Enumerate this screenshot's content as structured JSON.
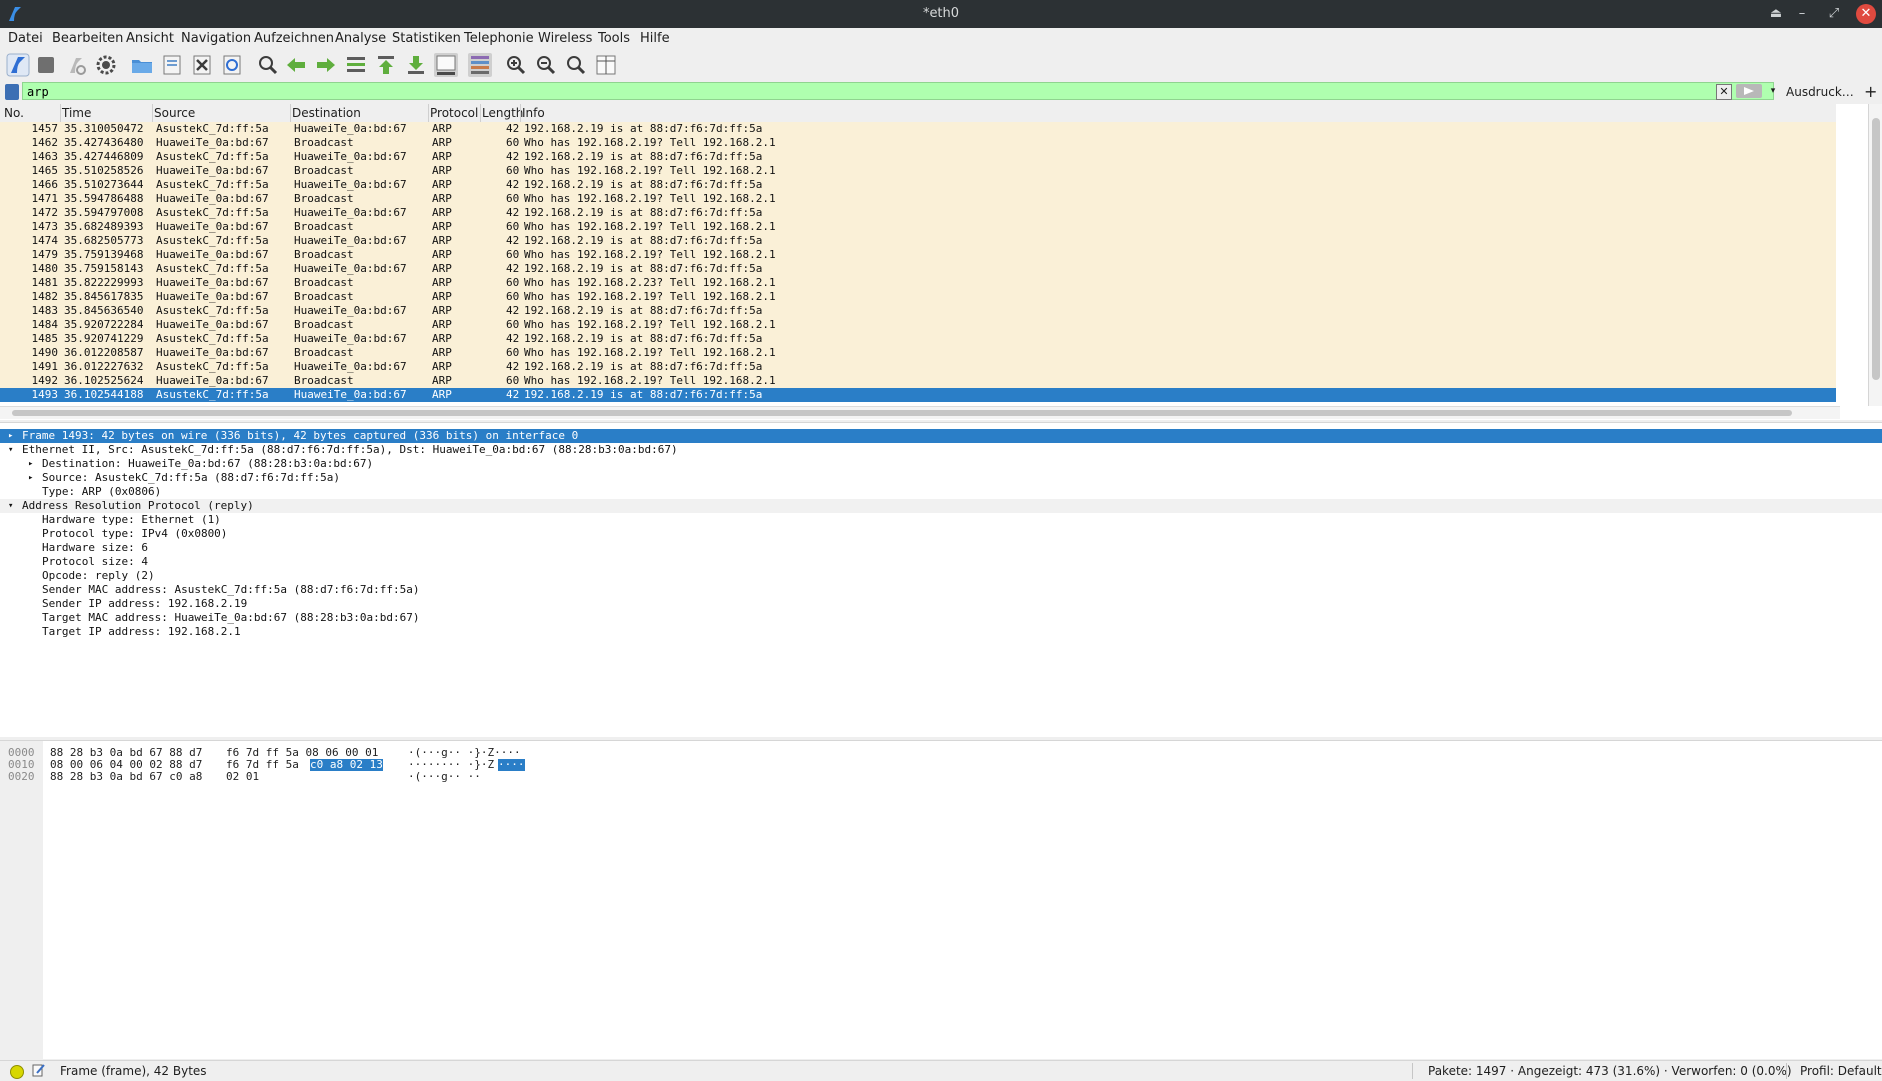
{
  "window": {
    "title": "*eth0"
  },
  "menu": [
    "Datei",
    "Bearbeiten",
    "Ansicht",
    "Navigation",
    "Aufzeichnen",
    "Analyse",
    "Statistiken",
    "Telephonie",
    "Wireless",
    "Tools",
    "Hilfe"
  ],
  "toolbar": {
    "icons": [
      "shark-fin-icon",
      "stop-icon",
      "restart-icon",
      "gear-icon",
      "folder-open-icon",
      "file-icon",
      "close-file-icon",
      "reload-icon",
      "search-icon",
      "arrow-left-icon",
      "arrow-right-icon",
      "go-to-packet-icon",
      "go-first-icon",
      "go-last-icon",
      "auto-scroll-icon",
      "colorize-icon",
      "zoom-in-icon",
      "zoom-out-icon",
      "zoom-normal-icon",
      "resize-columns-icon"
    ]
  },
  "filter": {
    "value": "arp",
    "expression_label": "Ausdruck…",
    "plus_label": "+",
    "clear_label": "✕",
    "dropdown_label": "▾"
  },
  "packet_list": {
    "columns": [
      "No.",
      "Time",
      "Source",
      "Destination",
      "Protocol",
      "Length",
      "Info"
    ],
    "rows": [
      {
        "no": "1457",
        "time": "35.310050472",
        "src": "AsustekC_7d:ff:5a",
        "dst": "HuaweiTe_0a:bd:67",
        "proto": "ARP",
        "len": "42",
        "info": "192.168.2.19 is at 88:d7:f6:7d:ff:5a"
      },
      {
        "no": "1462",
        "time": "35.427436480",
        "src": "HuaweiTe_0a:bd:67",
        "dst": "Broadcast",
        "proto": "ARP",
        "len": "60",
        "info": "Who has 192.168.2.19? Tell 192.168.2.1"
      },
      {
        "no": "1463",
        "time": "35.427446809",
        "src": "AsustekC_7d:ff:5a",
        "dst": "HuaweiTe_0a:bd:67",
        "proto": "ARP",
        "len": "42",
        "info": "192.168.2.19 is at 88:d7:f6:7d:ff:5a"
      },
      {
        "no": "1465",
        "time": "35.510258526",
        "src": "HuaweiTe_0a:bd:67",
        "dst": "Broadcast",
        "proto": "ARP",
        "len": "60",
        "info": "Who has 192.168.2.19? Tell 192.168.2.1"
      },
      {
        "no": "1466",
        "time": "35.510273644",
        "src": "AsustekC_7d:ff:5a",
        "dst": "HuaweiTe_0a:bd:67",
        "proto": "ARP",
        "len": "42",
        "info": "192.168.2.19 is at 88:d7:f6:7d:ff:5a"
      },
      {
        "no": "1471",
        "time": "35.594786488",
        "src": "HuaweiTe_0a:bd:67",
        "dst": "Broadcast",
        "proto": "ARP",
        "len": "60",
        "info": "Who has 192.168.2.19? Tell 192.168.2.1"
      },
      {
        "no": "1472",
        "time": "35.594797008",
        "src": "AsustekC_7d:ff:5a",
        "dst": "HuaweiTe_0a:bd:67",
        "proto": "ARP",
        "len": "42",
        "info": "192.168.2.19 is at 88:d7:f6:7d:ff:5a"
      },
      {
        "no": "1473",
        "time": "35.682489393",
        "src": "HuaweiTe_0a:bd:67",
        "dst": "Broadcast",
        "proto": "ARP",
        "len": "60",
        "info": "Who has 192.168.2.19? Tell 192.168.2.1"
      },
      {
        "no": "1474",
        "time": "35.682505773",
        "src": "AsustekC_7d:ff:5a",
        "dst": "HuaweiTe_0a:bd:67",
        "proto": "ARP",
        "len": "42",
        "info": "192.168.2.19 is at 88:d7:f6:7d:ff:5a"
      },
      {
        "no": "1479",
        "time": "35.759139468",
        "src": "HuaweiTe_0a:bd:67",
        "dst": "Broadcast",
        "proto": "ARP",
        "len": "60",
        "info": "Who has 192.168.2.19? Tell 192.168.2.1"
      },
      {
        "no": "1480",
        "time": "35.759158143",
        "src": "AsustekC_7d:ff:5a",
        "dst": "HuaweiTe_0a:bd:67",
        "proto": "ARP",
        "len": "42",
        "info": "192.168.2.19 is at 88:d7:f6:7d:ff:5a"
      },
      {
        "no": "1481",
        "time": "35.822229993",
        "src": "HuaweiTe_0a:bd:67",
        "dst": "Broadcast",
        "proto": "ARP",
        "len": "60",
        "info": "Who has 192.168.2.23? Tell 192.168.2.1"
      },
      {
        "no": "1482",
        "time": "35.845617835",
        "src": "HuaweiTe_0a:bd:67",
        "dst": "Broadcast",
        "proto": "ARP",
        "len": "60",
        "info": "Who has 192.168.2.19? Tell 192.168.2.1"
      },
      {
        "no": "1483",
        "time": "35.845636540",
        "src": "AsustekC_7d:ff:5a",
        "dst": "HuaweiTe_0a:bd:67",
        "proto": "ARP",
        "len": "42",
        "info": "192.168.2.19 is at 88:d7:f6:7d:ff:5a"
      },
      {
        "no": "1484",
        "time": "35.920722284",
        "src": "HuaweiTe_0a:bd:67",
        "dst": "Broadcast",
        "proto": "ARP",
        "len": "60",
        "info": "Who has 192.168.2.19? Tell 192.168.2.1"
      },
      {
        "no": "1485",
        "time": "35.920741229",
        "src": "AsustekC_7d:ff:5a",
        "dst": "HuaweiTe_0a:bd:67",
        "proto": "ARP",
        "len": "42",
        "info": "192.168.2.19 is at 88:d7:f6:7d:ff:5a"
      },
      {
        "no": "1490",
        "time": "36.012208587",
        "src": "HuaweiTe_0a:bd:67",
        "dst": "Broadcast",
        "proto": "ARP",
        "len": "60",
        "info": "Who has 192.168.2.19? Tell 192.168.2.1"
      },
      {
        "no": "1491",
        "time": "36.012227632",
        "src": "AsustekC_7d:ff:5a",
        "dst": "HuaweiTe_0a:bd:67",
        "proto": "ARP",
        "len": "42",
        "info": "192.168.2.19 is at 88:d7:f6:7d:ff:5a"
      },
      {
        "no": "1492",
        "time": "36.102525624",
        "src": "HuaweiTe_0a:bd:67",
        "dst": "Broadcast",
        "proto": "ARP",
        "len": "60",
        "info": "Who has 192.168.2.19? Tell 192.168.2.1"
      },
      {
        "no": "1493",
        "time": "36.102544188",
        "src": "AsustekC_7d:ff:5a",
        "dst": "HuaweiTe_0a:bd:67",
        "proto": "ARP",
        "len": "42",
        "info": "192.168.2.19 is at 88:d7:f6:7d:ff:5a",
        "selected": true
      }
    ]
  },
  "details": [
    {
      "text": "Frame 1493: 42 bytes on wire (336 bits), 42 bytes captured (336 bits) on interface 0",
      "level": 0,
      "arrow": "▸",
      "selected": true
    },
    {
      "text": "Ethernet II, Src: AsustekC_7d:ff:5a (88:d7:f6:7d:ff:5a), Dst: HuaweiTe_0a:bd:67 (88:28:b3:0a:bd:67)",
      "level": 0,
      "arrow": "▾"
    },
    {
      "text": "Destination: HuaweiTe_0a:bd:67 (88:28:b3:0a:bd:67)",
      "level": 1,
      "arrow": "▸"
    },
    {
      "text": "Source: AsustekC_7d:ff:5a (88:d7:f6:7d:ff:5a)",
      "level": 1,
      "arrow": "▸"
    },
    {
      "text": "Type: ARP (0x0806)",
      "level": 1,
      "arrow": ""
    },
    {
      "text": "Address Resolution Protocol (reply)",
      "level": 0,
      "arrow": "▾",
      "section": true
    },
    {
      "text": "Hardware type: Ethernet (1)",
      "level": 1,
      "arrow": ""
    },
    {
      "text": "Protocol type: IPv4 (0x0800)",
      "level": 1,
      "arrow": ""
    },
    {
      "text": "Hardware size: 6",
      "level": 1,
      "arrow": ""
    },
    {
      "text": "Protocol size: 4",
      "level": 1,
      "arrow": ""
    },
    {
      "text": "Opcode: reply (2)",
      "level": 1,
      "arrow": ""
    },
    {
      "text": "Sender MAC address: AsustekC_7d:ff:5a (88:d7:f6:7d:ff:5a)",
      "level": 1,
      "arrow": ""
    },
    {
      "text": "Sender IP address: 192.168.2.19",
      "level": 1,
      "arrow": ""
    },
    {
      "text": "Target MAC address: HuaweiTe_0a:bd:67 (88:28:b3:0a:bd:67)",
      "level": 1,
      "arrow": ""
    },
    {
      "text": "Target IP address: 192.168.2.1",
      "level": 1,
      "arrow": ""
    }
  ],
  "bytes": [
    {
      "offset": "0000",
      "hex_a": "88 28 b3 0a bd 67 88 d7",
      "hex_b": "f6 7d ff 5a 08 06 00 01",
      "ascii": "·(···g·· ·}·Z····"
    },
    {
      "offset": "0010",
      "hex_a": "08 00 06 04 00 02 88 d7",
      "hex_b": "f6 7d ff 5a",
      "hex_hl": "c0 a8 02 13",
      "ascii": "········ ·}·Z",
      "ascii_hl": "····"
    },
    {
      "offset": "0020",
      "hex_a": "88 28 b3 0a bd 67 c0 a8",
      "hex_b": "02 01",
      "ascii": "·(···g·· ··"
    }
  ],
  "status": {
    "left": "Frame (frame), 42 Bytes",
    "packets": "Pakete: 1497 · Angezeigt: 473 (31.6%) · Verworfen: 0 (0.0%)",
    "profile": "Profil: Default"
  },
  "colors": {
    "selection": "#2a7ec7",
    "row_bg": "#faf0d7",
    "filter_ok": "#afffaf",
    "titlebar": "#2c3134"
  }
}
